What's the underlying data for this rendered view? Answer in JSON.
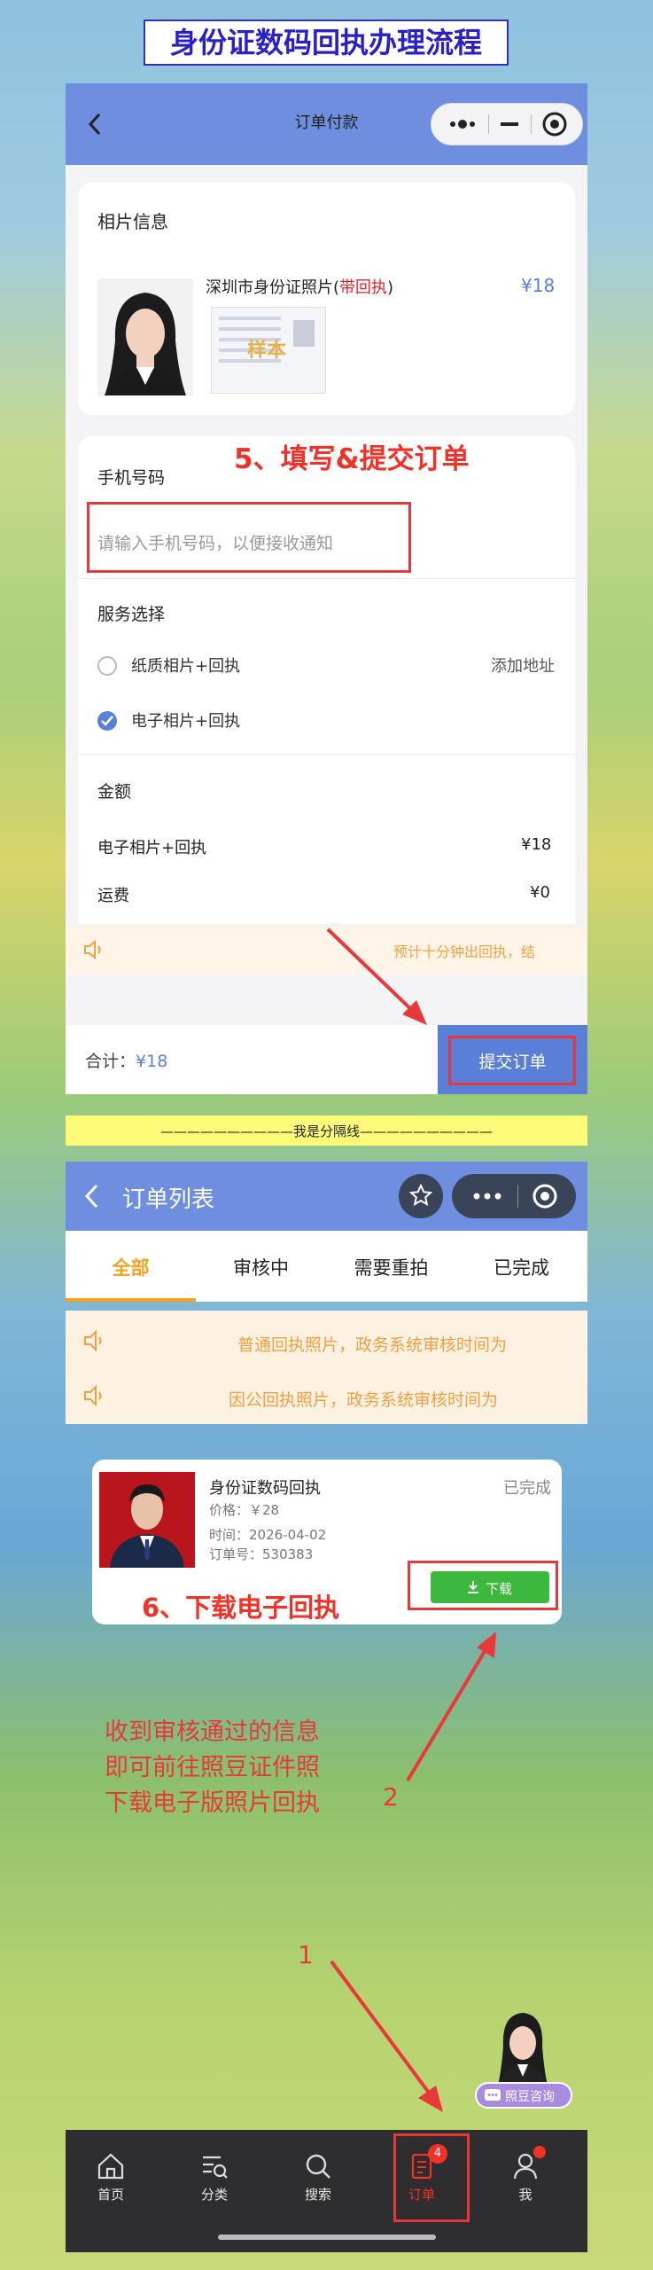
{
  "header_title": "身份证数码回执办理流程",
  "order_pay": {
    "nav_title": "订单付款",
    "photo_section_title": "相片信息",
    "product_name": "深圳市身份证照片",
    "product_tag": "带回执",
    "product_price": "¥18",
    "sample_stamp": "样本",
    "step5_annotation": "5、填写&提交订单",
    "phone_label": "手机号码",
    "phone_placeholder": "请输入手机号码，以便接收通知",
    "service_label": "服务选择",
    "service_options": [
      {
        "label": "纸质相片+回执",
        "selected": false,
        "extra": "添加地址"
      },
      {
        "label": "电子相片+回执",
        "selected": true,
        "extra": ""
      }
    ],
    "amount_label": "金额",
    "amount_rows": [
      {
        "label": "电子相片+回执",
        "value": "¥18"
      },
      {
        "label": "运费",
        "value": "¥0"
      }
    ],
    "notice_text": "预计十分钟出回执，结",
    "total_label": "合计：",
    "total_value": "¥18",
    "submit_label": "提交订单"
  },
  "divider_text": "——————————我是分隔线——————————",
  "order_list": {
    "nav_title": "订单列表",
    "tabs": [
      {
        "label": "全部",
        "active": true
      },
      {
        "label": "审核中",
        "active": false
      },
      {
        "label": "需要重拍",
        "active": false
      },
      {
        "label": "已完成",
        "active": false
      }
    ],
    "notices": [
      "普通回执照片，政务系统审核时间为",
      "因公回执照片，政务系统审核时间为"
    ],
    "order": {
      "title": "身份证数码回执",
      "status": "已完成",
      "price": "价格：￥28",
      "time": "时间：2026-04-02",
      "order_no": "订单号：530383",
      "download_label": "下载"
    },
    "step6_annotation": "6、下载电子回执",
    "explain_lines": [
      "收到审核通过的信息",
      "即可前往照豆证件照",
      "下载电子版照片回执"
    ],
    "num_2": "2",
    "num_1": "1",
    "consult_label": "照豆咨询",
    "tabbar": [
      {
        "label": "首页",
        "icon": "home-icon"
      },
      {
        "label": "分类",
        "icon": "category-icon"
      },
      {
        "label": "搜索",
        "icon": "search-icon"
      },
      {
        "label": "订单",
        "icon": "order-icon",
        "badge": "4"
      },
      {
        "label": "我",
        "icon": "user-icon"
      }
    ]
  },
  "colors": {
    "accent_blue": "#6e8fe0",
    "annotation_red": "#f03228",
    "orange_tab": "#f5a020",
    "green_button": "#3cb83c"
  }
}
